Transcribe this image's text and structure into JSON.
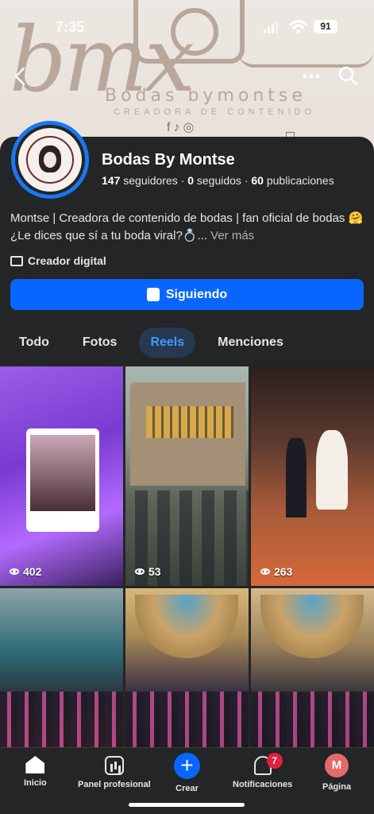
{
  "status_bar": {
    "time": "7:35",
    "battery": "91"
  },
  "cover": {
    "brand": "Bodas bymontse",
    "script_mark": "bmx",
    "tagline": "CREADORA DE CONTENIDO"
  },
  "profile": {
    "name": "Bodas By Montse",
    "followers_count": "147",
    "followers_label": "seguidores",
    "following_count": "0",
    "following_label": "seguidos",
    "posts_count": "60",
    "posts_label": "publicaciones",
    "separator": "·",
    "bio": "Montse | Creadora de contenido de bodas | fan oficial de bodas 🤗 ¿Le dices que sí a tu boda viral?💍...",
    "bio_more": "Ver más",
    "category": "Creador digital",
    "follow_button": "Siguiendo"
  },
  "tabs": [
    {
      "label": "Todo",
      "active": false
    },
    {
      "label": "Fotos",
      "active": false
    },
    {
      "label": "Reels",
      "active": true
    },
    {
      "label": "Menciones",
      "active": false
    }
  ],
  "reels": [
    {
      "views": "402"
    },
    {
      "views": "53"
    },
    {
      "views": "263"
    },
    {
      "views": ""
    },
    {
      "views": ""
    },
    {
      "views": ""
    }
  ],
  "bottom_nav": [
    {
      "label": "Inicio",
      "icon": "home-icon"
    },
    {
      "label": "Panel profesional",
      "icon": "dashboard-icon"
    },
    {
      "label": "Crear",
      "icon": "plus-icon"
    },
    {
      "label": "Notificaciones",
      "icon": "bell-icon",
      "badge": "7"
    },
    {
      "label": "Página",
      "icon": "page-avatar",
      "initial": "M"
    }
  ],
  "colors": {
    "accent": "#0866ff",
    "tab_active_bg": "#263951",
    "tab_active_text": "#4599ff",
    "badge": "#e41e3f"
  }
}
